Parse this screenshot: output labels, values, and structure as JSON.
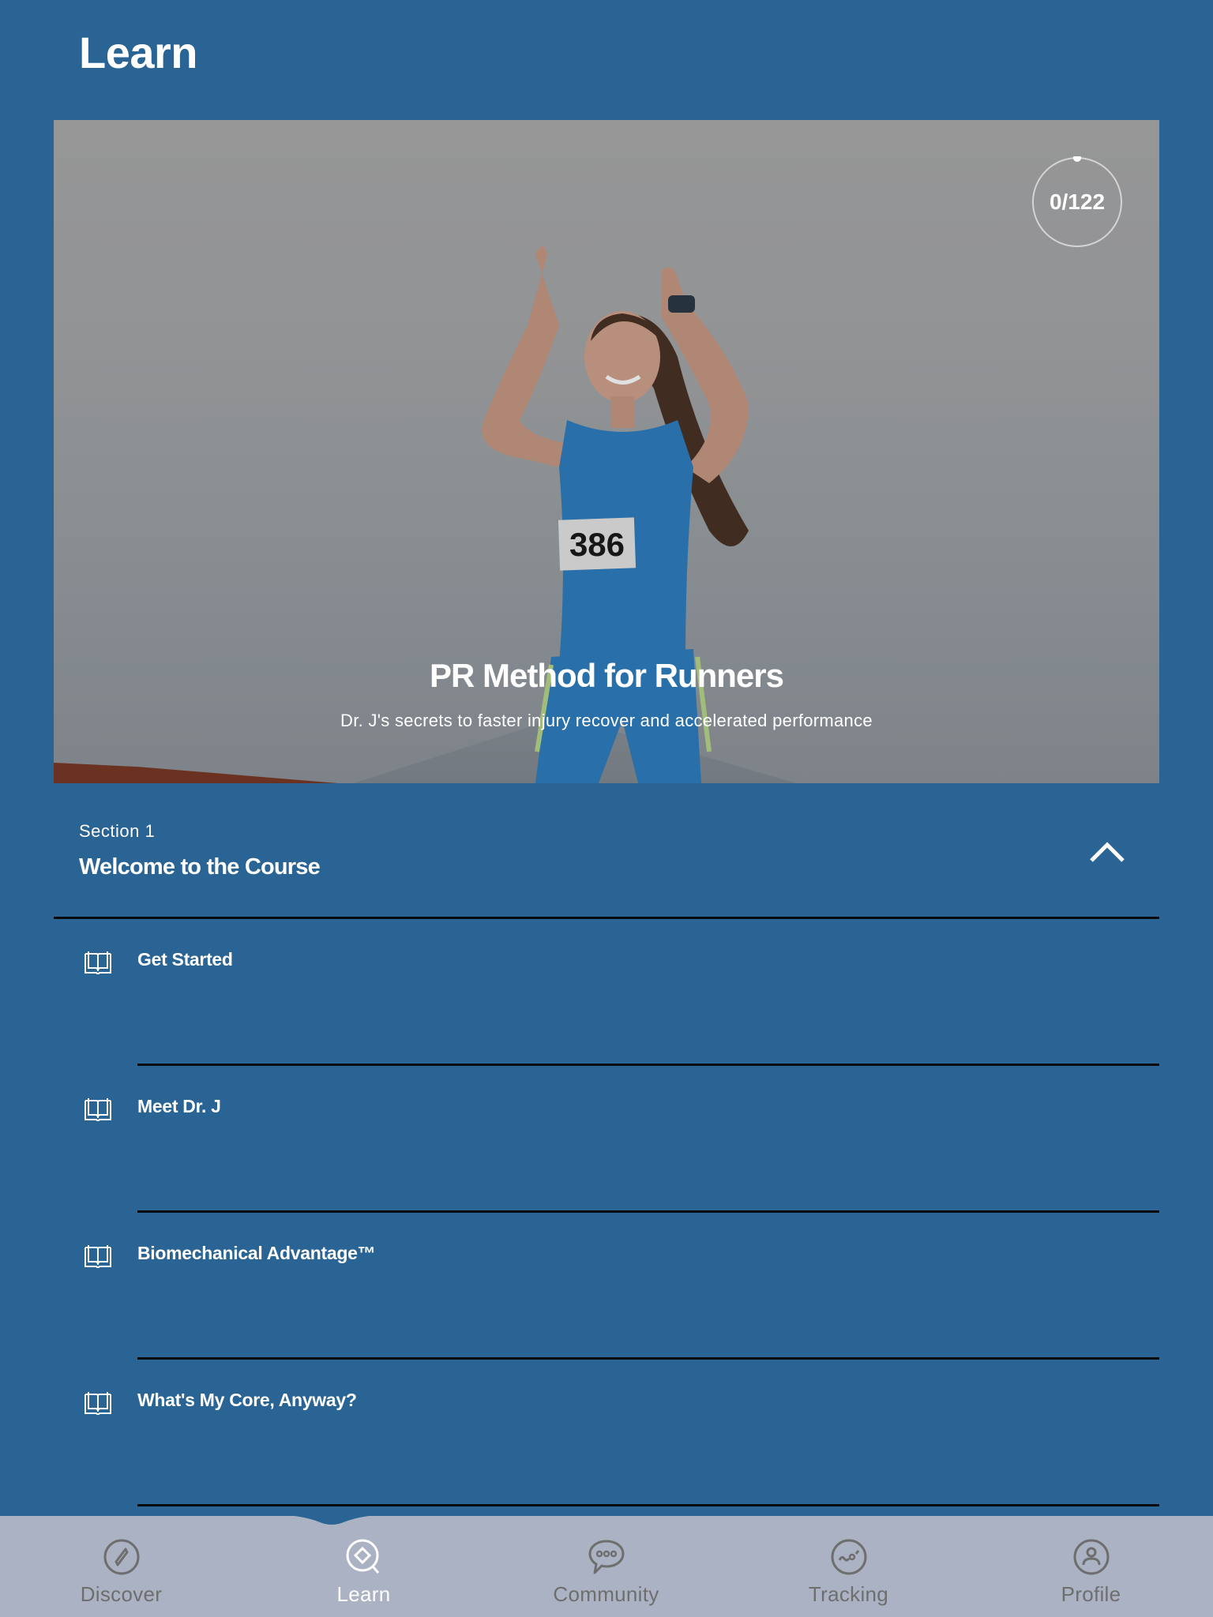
{
  "header": {
    "title": "Learn"
  },
  "course": {
    "title": "PR Method for Runners",
    "subtitle": "Dr. J's secrets to faster injury recover and accelerated performance",
    "progress": {
      "completed": 0,
      "total": 122,
      "label": "0/122"
    },
    "bib_number": "386"
  },
  "section": {
    "label": "Section 1",
    "title": "Welcome to the Course",
    "expanded": true,
    "toggle_icon": "chevron-up-icon"
  },
  "lessons": [
    {
      "title": "Get Started",
      "icon": "book-icon"
    },
    {
      "title": "Meet Dr. J",
      "icon": "book-icon"
    },
    {
      "title": "Biomechanical Advantage™",
      "icon": "book-icon"
    },
    {
      "title": "What's My Core, Anyway?",
      "icon": "book-icon"
    }
  ],
  "tabbar": {
    "active": "Learn",
    "tabs": [
      {
        "label": "Discover",
        "icon": "compass-icon"
      },
      {
        "label": "Learn",
        "icon": "learn-search-icon"
      },
      {
        "label": "Community",
        "icon": "chat-bubble-icon"
      },
      {
        "label": "Tracking",
        "icon": "tracking-chart-icon"
      },
      {
        "label": "Profile",
        "icon": "user-icon"
      }
    ]
  },
  "colors": {
    "background": "#2a6494",
    "tabbar": "#abb2c4",
    "tab_inactive": "#6e6e6e",
    "tab_active": "#ffffff",
    "divider": "#0b0b0b"
  }
}
